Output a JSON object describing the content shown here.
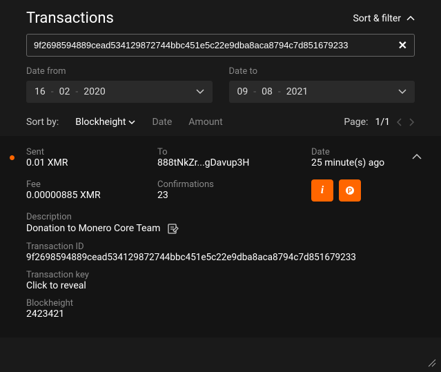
{
  "header": {
    "title": "Transactions",
    "sort_filter_label": "Sort & filter"
  },
  "search": {
    "value": "9f2698594889cead534129872744bbc451e5c22e9dba8aca8794c7d851679233"
  },
  "date_from": {
    "label": "Date from",
    "day": "16",
    "month": "02",
    "year": "2020"
  },
  "date_to": {
    "label": "Date to",
    "day": "09",
    "month": "08",
    "year": "2021"
  },
  "sort": {
    "label": "Sort by:",
    "blockheight": "Blockheight",
    "date": "Date",
    "amount": "Amount"
  },
  "pagination": {
    "label": "Page:",
    "current": "1/1"
  },
  "tx": {
    "sent_label": "Sent",
    "sent_value": "0.01 XMR",
    "to_label": "To",
    "to_value": "888tNkZr...gDavup3H",
    "date_label": "Date",
    "date_value": "25 minute(s) ago",
    "fee_label": "Fee",
    "fee_value": "0.00000885 XMR",
    "conf_label": "Confirmations",
    "conf_value": "23",
    "desc_label": "Description",
    "desc_value": "Donation to Monero Core Team",
    "txid_label": "Transaction ID",
    "txid_value": "9f2698594889cead534129872744bbc451e5c22e9dba8aca8794c7d851679233",
    "txkey_label": "Transaction key",
    "txkey_value": "Click to reveal",
    "bh_label": "Blockheight",
    "bh_value": "2423421"
  }
}
